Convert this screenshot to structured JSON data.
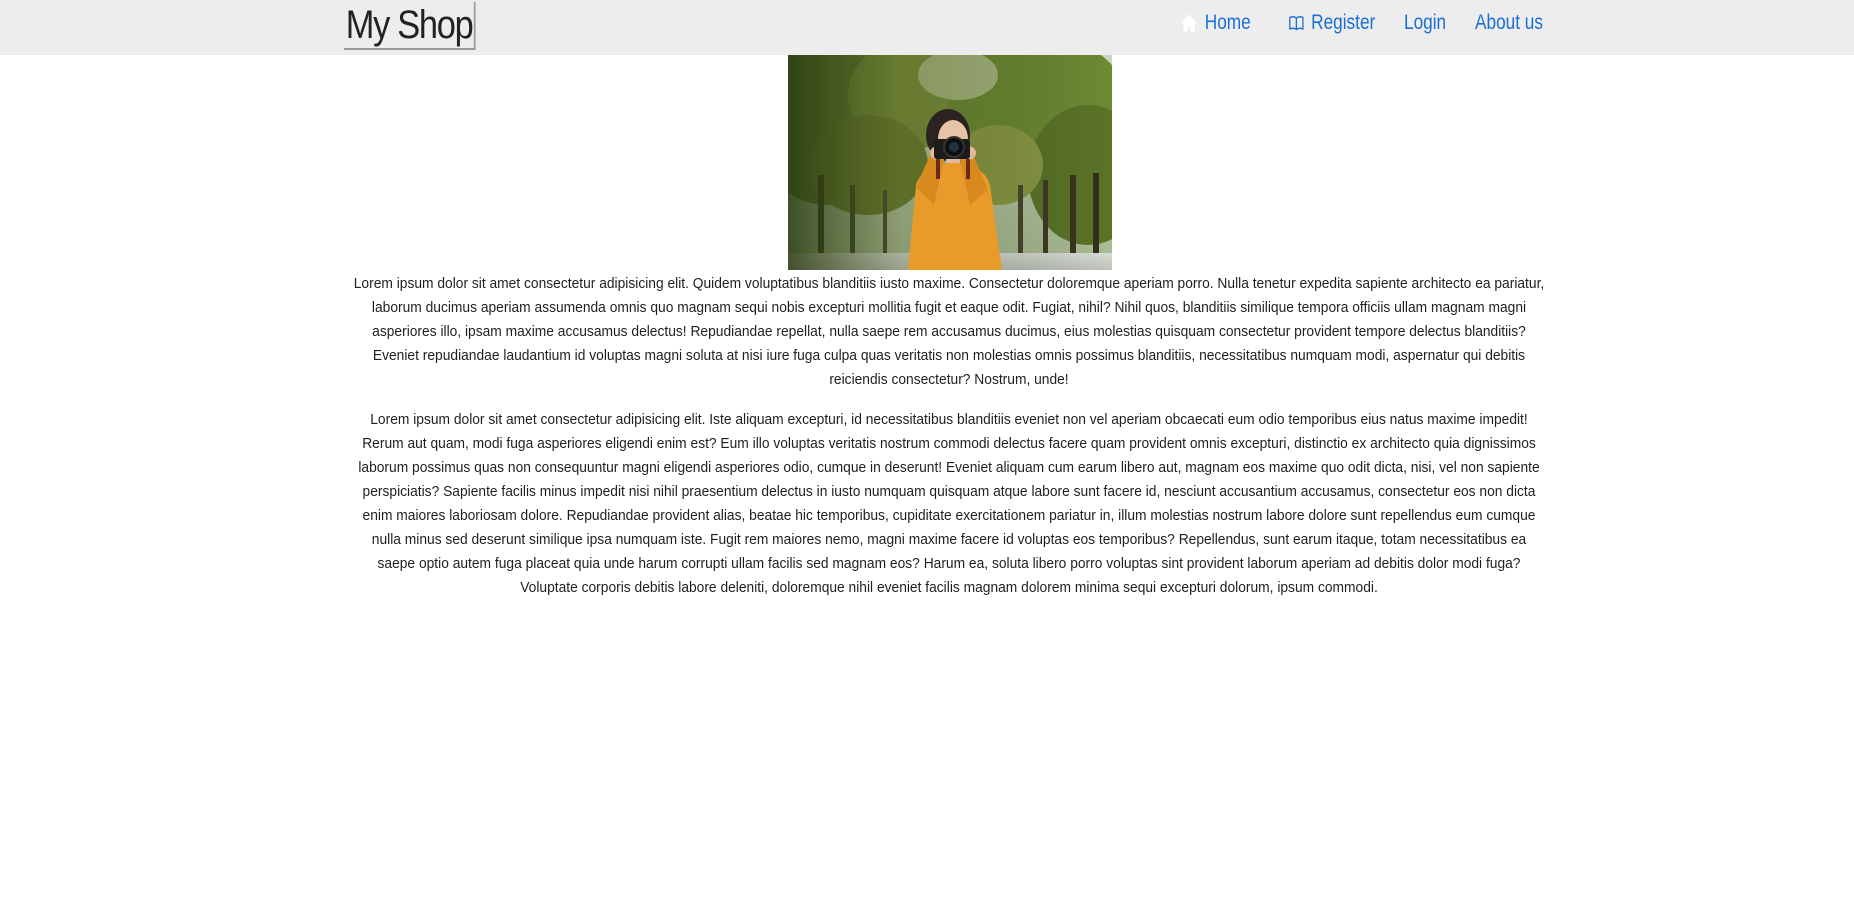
{
  "brand": {
    "title": "My Shop"
  },
  "nav": {
    "items": [
      {
        "label": "Home",
        "icon": "home-icon"
      },
      {
        "label": "Register",
        "icon": "book-icon"
      },
      {
        "label": "Login",
        "icon": ""
      },
      {
        "label": "About us",
        "icon": ""
      }
    ],
    "link_color": "#1a6fd6",
    "bar_color": "#ededed"
  },
  "hero": {
    "subject": "woman in orange sweater holding a camera among trees"
  },
  "content": {
    "paragraphs": [
      "Lorem ipsum dolor sit amet consectetur adipisicing elit. Quidem voluptatibus blanditiis iusto maxime. Consectetur doloremque aperiam porro. Nulla tenetur expedita sapiente architecto ea pariatur, laborum ducimus aperiam assumenda omnis quo magnam sequi nobis excepturi mollitia fugit et eaque odit. Fugiat, nihil? Nihil quos, blanditiis similique tempora officiis ullam magnam magni asperiores illo, ipsam maxime accusamus delectus! Repudiandae repellat, nulla saepe rem accusamus ducimus, eius molestias quisquam consectetur provident tempore delectus blanditiis? Eveniet repudiandae laudantium id voluptas magni soluta at nisi iure fuga culpa quas veritatis non molestias omnis possimus blanditiis, necessitatibus numquam modi, aspernatur qui debitis reiciendis consectetur? Nostrum, unde!",
      "Lorem ipsum dolor sit amet consectetur adipisicing elit. Iste aliquam excepturi, id necessitatibus blanditiis eveniet non vel aperiam obcaecati eum odio temporibus eius natus maxime impedit! Rerum aut quam, modi fuga asperiores eligendi enim est? Eum illo voluptas veritatis nostrum commodi delectus facere quam provident omnis excepturi, distinctio ex architecto quia dignissimos laborum possimus quas non consequuntur magni eligendi asperiores odio, cumque in deserunt! Eveniet aliquam cum earum libero aut, magnam eos maxime quo odit dicta, nisi, vel non sapiente perspiciatis? Sapiente facilis minus impedit nisi nihil praesentium delectus in iusto numquam quisquam atque labore sunt facere id, nesciunt accusantium accusamus, consectetur eos non dicta enim maiores laboriosam dolore. Repudiandae provident alias, beatae hic temporibus, cupiditate exercitationem pariatur in, illum molestias nostrum labore dolore sunt repellendus eum cumque nulla minus sed deserunt similique ipsa numquam iste. Fugit rem maiores nemo, magni maxime facere id voluptas eos temporibus? Repellendus, sunt earum itaque, totam necessitatibus ea saepe optio autem fuga placeat quia unde harum corrupti ullam facilis sed magnam eos? Harum ea, soluta libero porro voluptas sint provident laborum aperiam ad debitis dolor modi fuga? Voluptate corporis debitis labore deleniti, doloremque nihil eveniet facilis magnam dolorem minima sequi excepturi dolorum, ipsum commodi."
    ]
  }
}
